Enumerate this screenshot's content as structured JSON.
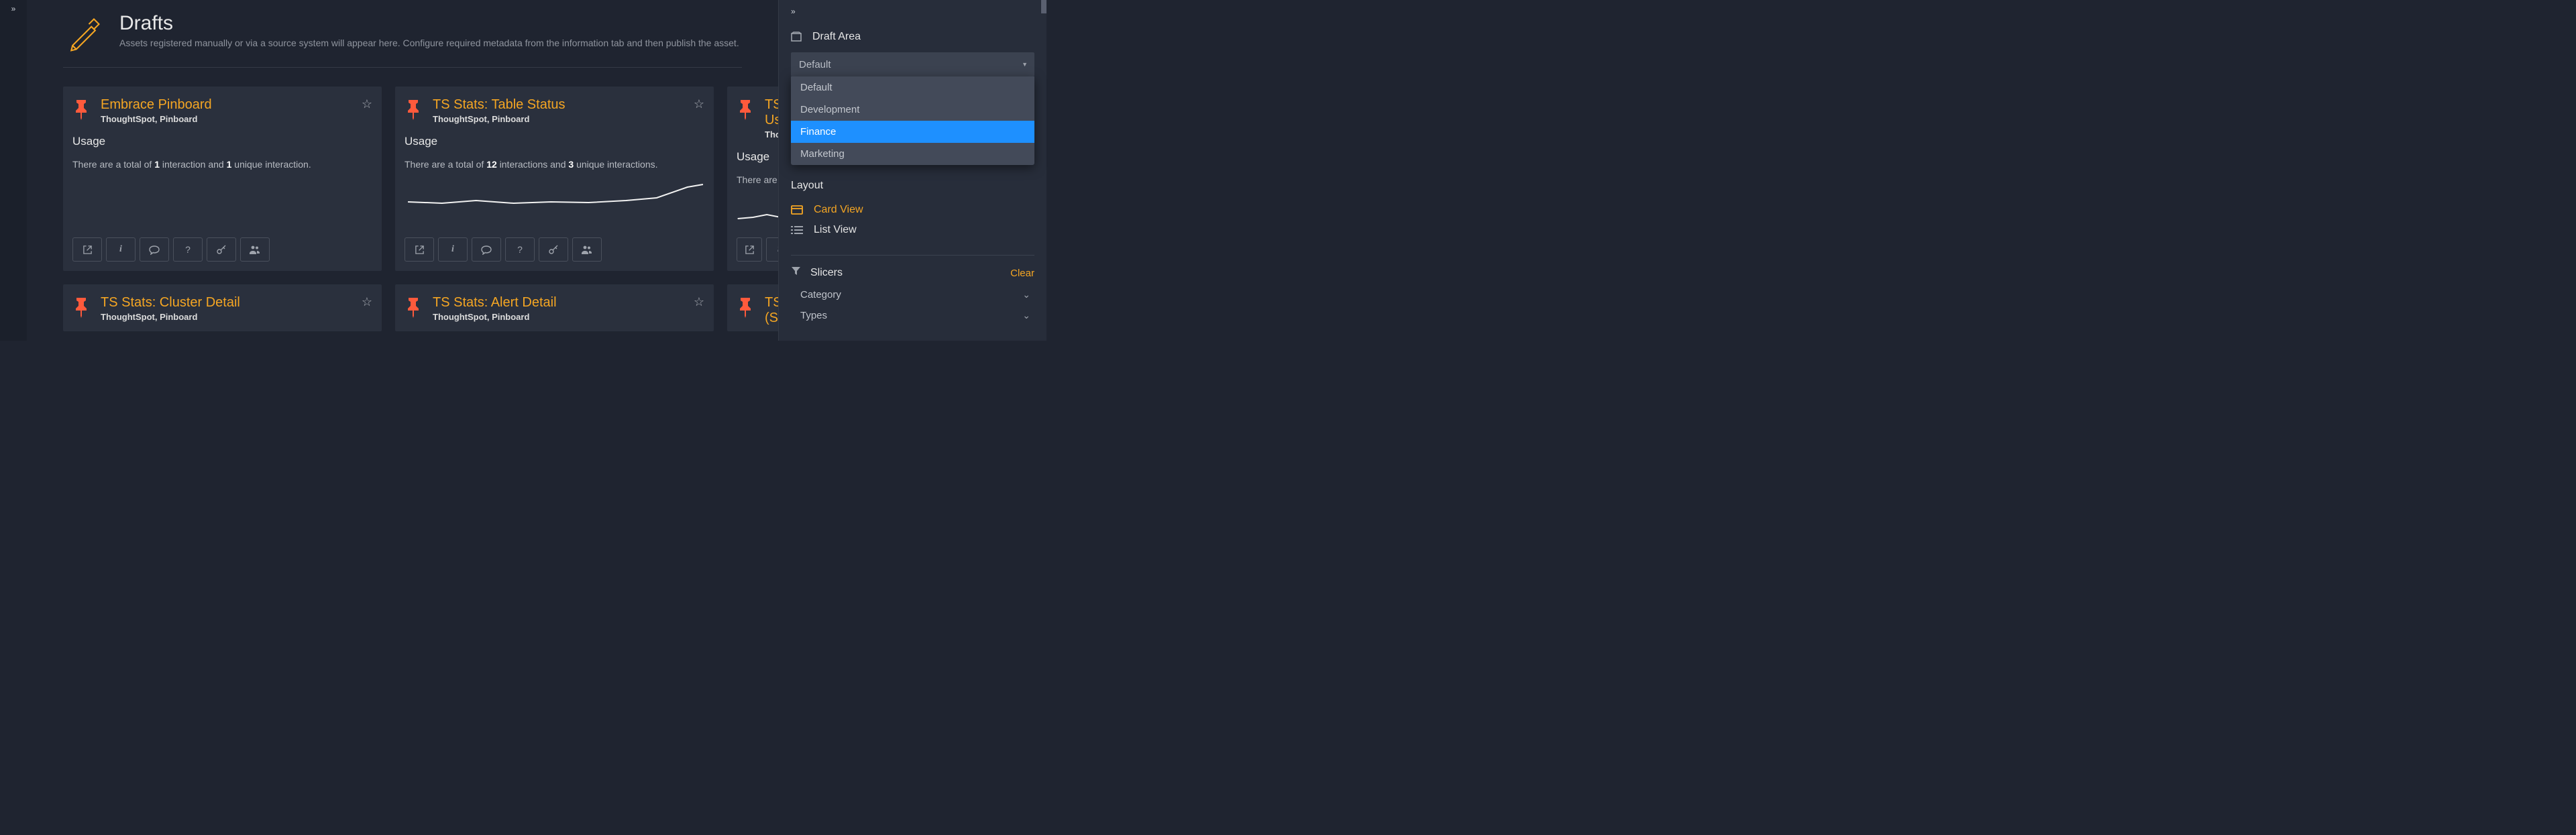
{
  "page": {
    "title": "Drafts",
    "subtitle": "Assets registered manually or via a source system will appear here. Configure required metadata from the information tab and then publish the asset."
  },
  "cards": [
    {
      "title": "Embrace Pinboard",
      "subtitle": "ThoughtSpot, Pinboard",
      "usage_label": "Usage",
      "usage_prefix": "There are a total of ",
      "usage_n1": "1",
      "usage_mid": " interaction and ",
      "usage_n2": "1",
      "usage_suffix": " unique interaction.",
      "has_sparkline": false
    },
    {
      "title": "TS Stats: Table Status",
      "subtitle": "ThoughtSpot, Pinboard",
      "usage_label": "Usage",
      "usage_prefix": "There are a total of ",
      "usage_n1": "12",
      "usage_mid": " interactions and ",
      "usage_n2": "3",
      "usage_suffix": " unique interactions.",
      "has_sparkline": true
    },
    {
      "title_line1": "TS",
      "title_line2": "Us",
      "subtitle": "Tho",
      "usage_label": "Usage",
      "usage_prefix": "There are a total o",
      "has_sparkline": true,
      "cut": true
    },
    {
      "title": "TS Stats: Cluster Detail",
      "subtitle": "ThoughtSpot, Pinboard"
    },
    {
      "title": "TS Stats: Alert Detail",
      "subtitle": "ThoughtSpot, Pinboard"
    },
    {
      "title_line1": "TS",
      "title_line2": "(Se",
      "cut": true
    }
  ],
  "right": {
    "draft_area_label": "Draft Area",
    "select_value": "Default",
    "select_options": [
      "Default",
      "Development",
      "Finance",
      "Marketing"
    ],
    "select_highlighted": "Finance",
    "layout_label": "Layout",
    "card_view": "Card View",
    "list_view": "List View",
    "slicers_label": "Slicers",
    "clear_label": "Clear",
    "category_label": "Category",
    "types_label": "Types"
  }
}
